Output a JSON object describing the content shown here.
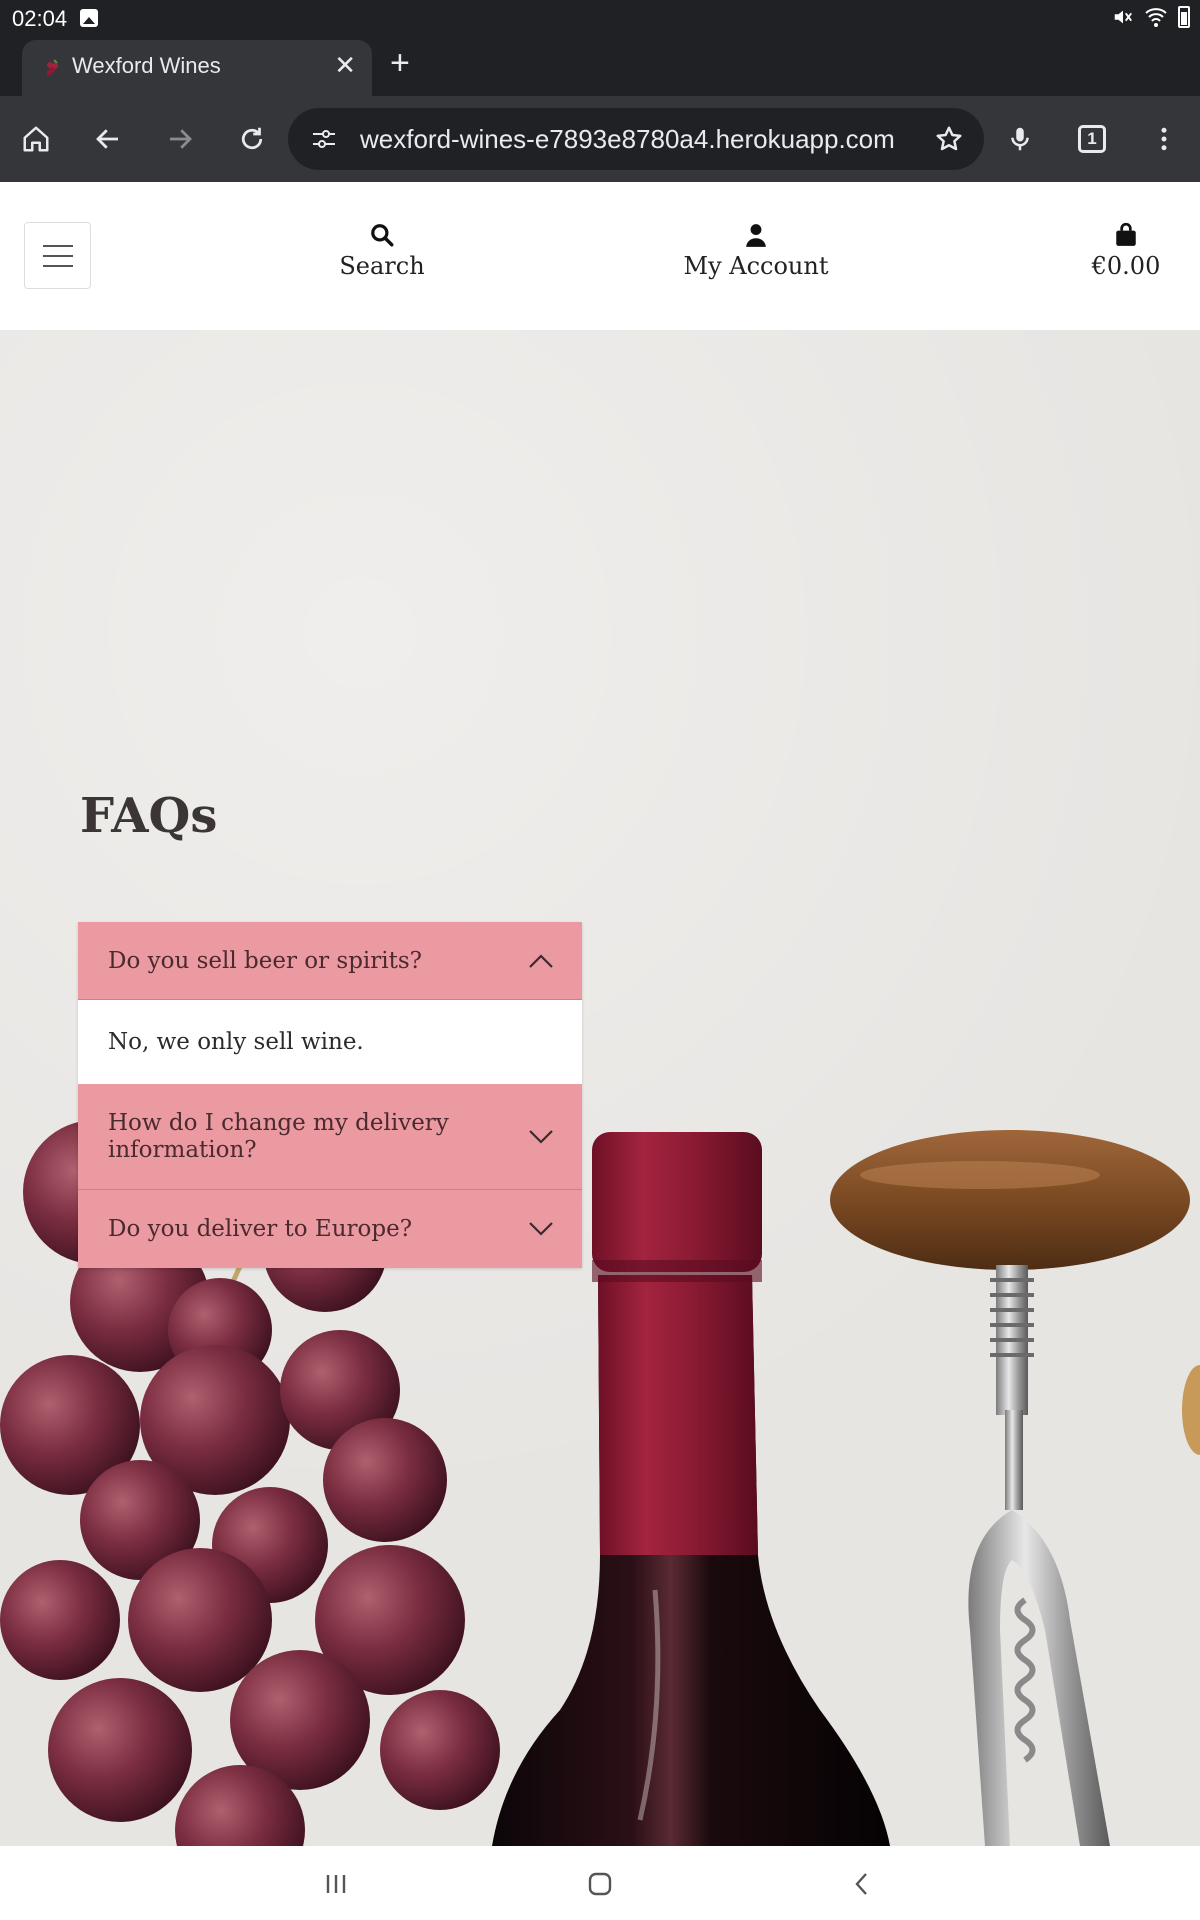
{
  "status_bar": {
    "time": "02:04"
  },
  "browser": {
    "tab": {
      "title": "Wexford Wines",
      "close_label": "✕"
    },
    "new_tab_label": "+",
    "url": "wexford-wines-e7893e8780a4.herokuapp.com",
    "tab_count": "1"
  },
  "site": {
    "nav": {
      "search_label": "Search",
      "account_label": "My Account",
      "cart_total": "€0.00"
    }
  },
  "faq": {
    "title": "FAQs",
    "items": [
      {
        "question": "Do you sell beer or spirits?",
        "answer": "No, we only sell wine.",
        "expanded": true
      },
      {
        "question": "How do I change my delivery information?",
        "expanded": false
      },
      {
        "question": "Do you deliver to Europe?",
        "expanded": false
      }
    ]
  },
  "colors": {
    "accordion_header": "#ea9aa0",
    "wine_red": "#8e1b35",
    "background_stone": "#e7e5e2"
  }
}
